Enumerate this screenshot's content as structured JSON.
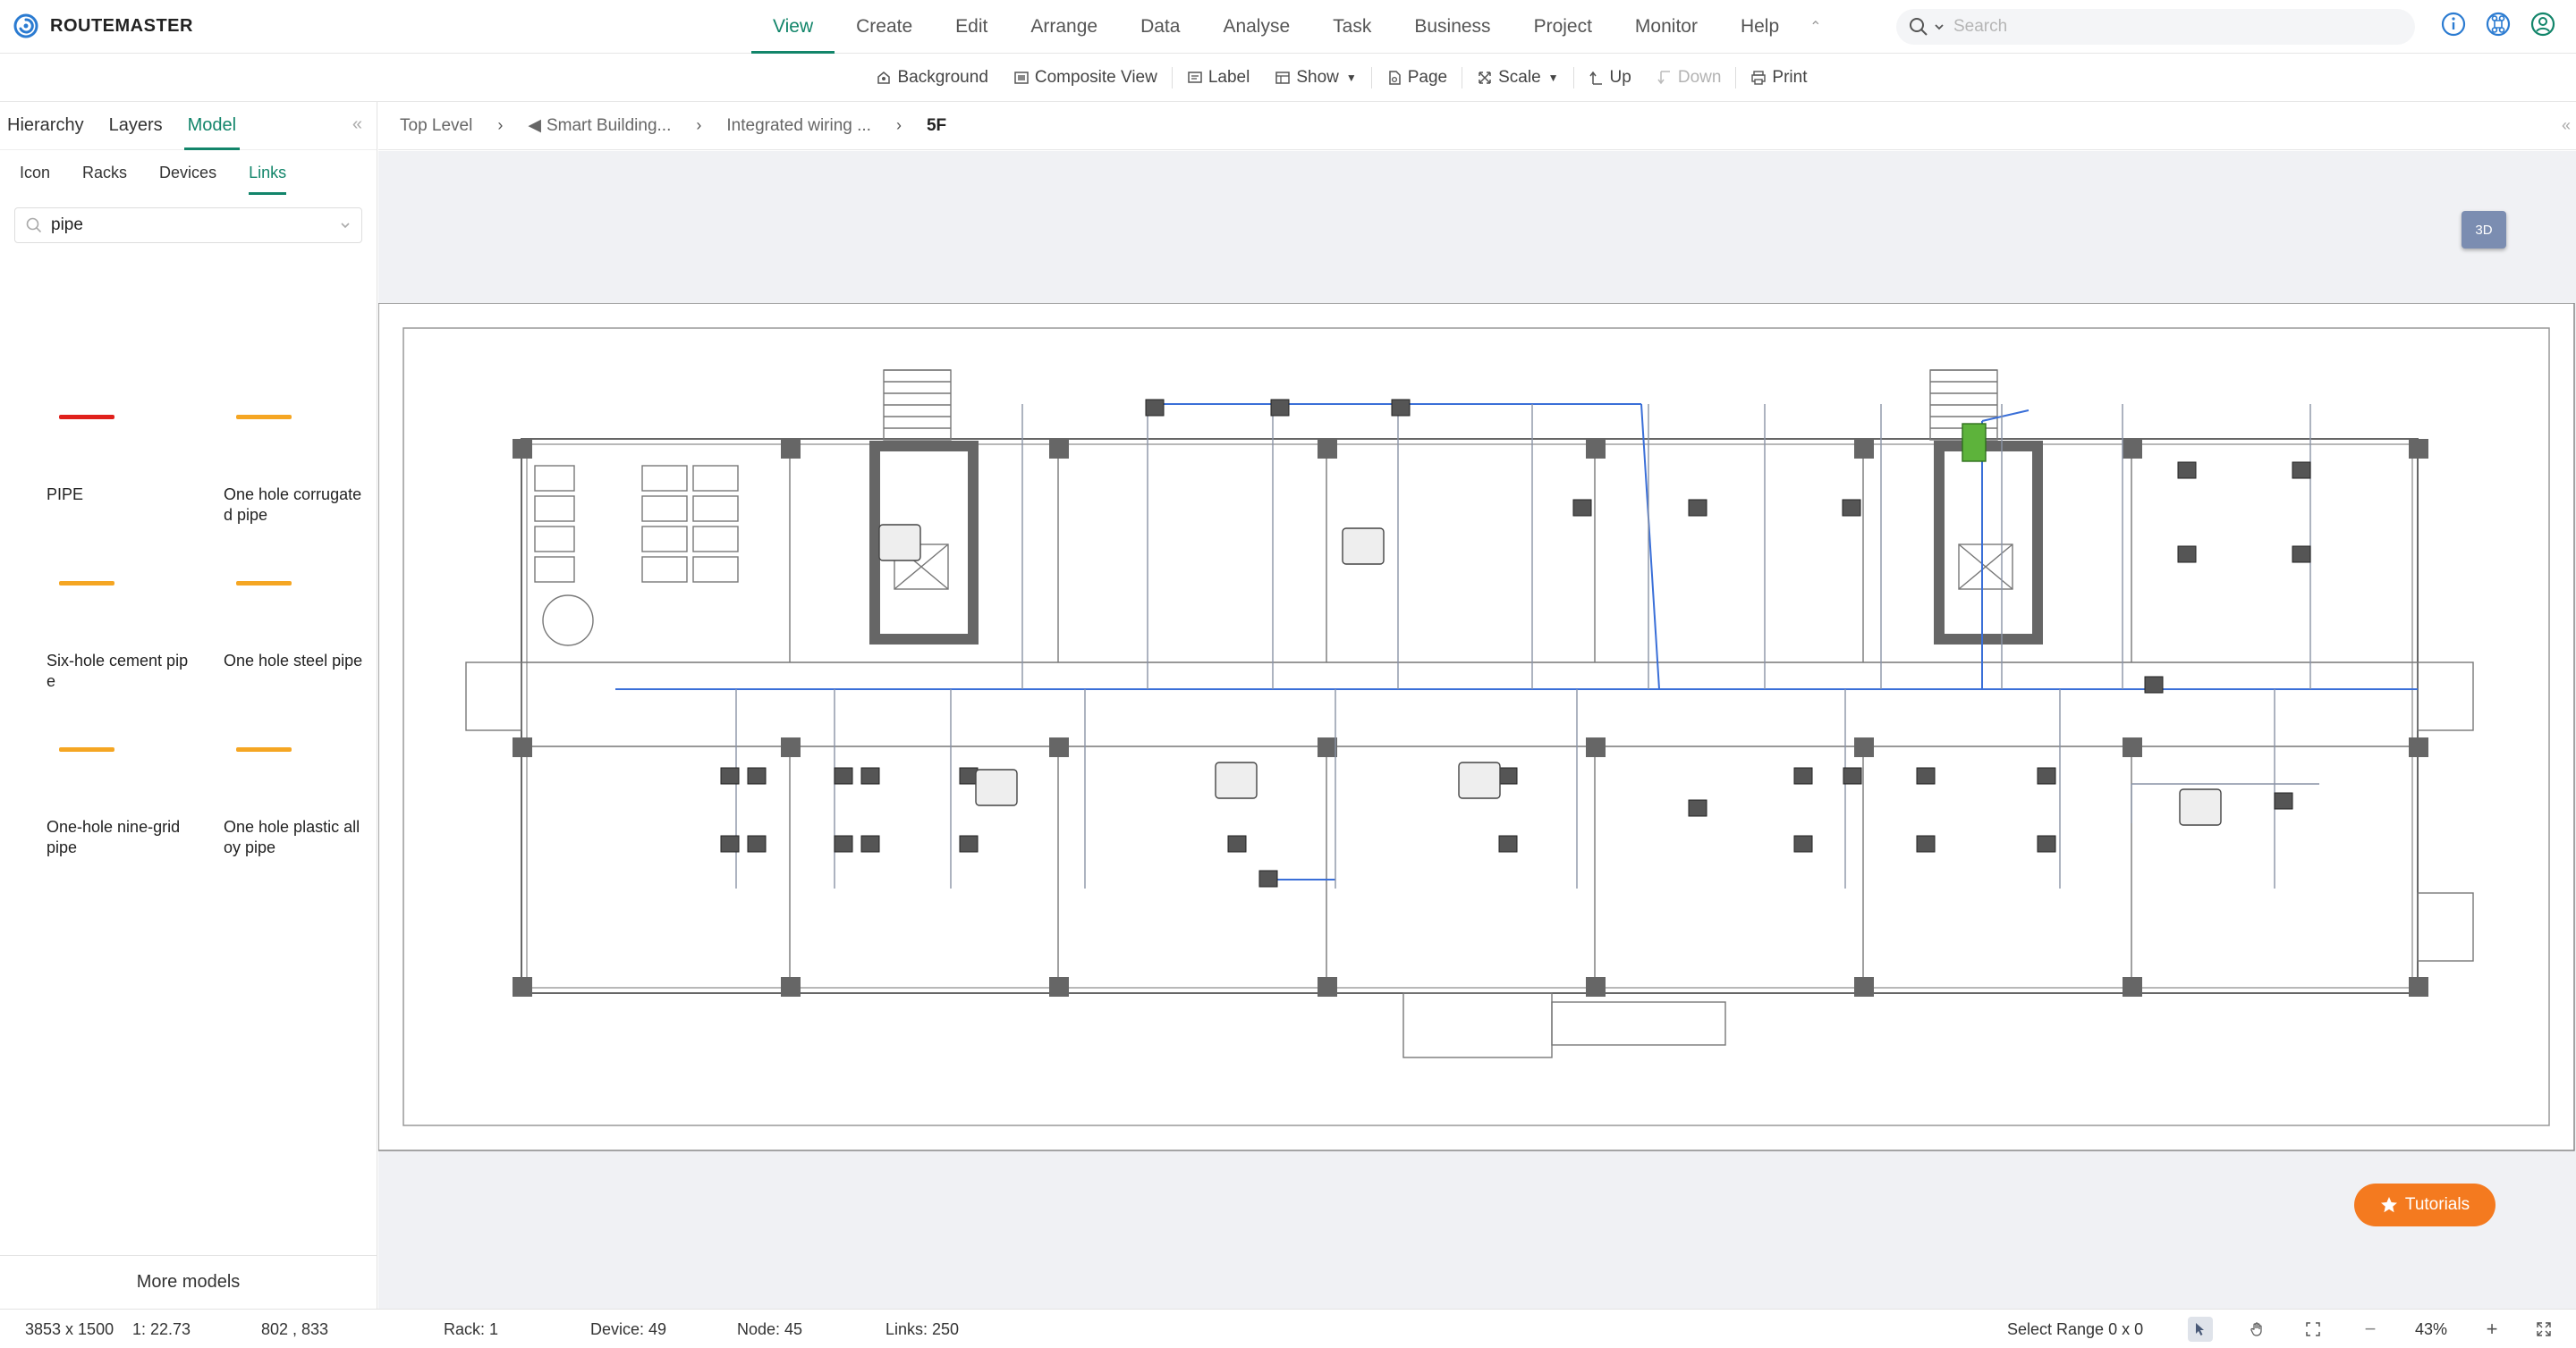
{
  "app": {
    "name": "ROUTEMASTER"
  },
  "menu": [
    "View",
    "Create",
    "Edit",
    "Arrange",
    "Data",
    "Analyse",
    "Task",
    "Business",
    "Project",
    "Monitor",
    "Help"
  ],
  "search": {
    "placeholder": "Search"
  },
  "toolbar": {
    "background": "Background",
    "composite_view": "Composite View",
    "label": "Label",
    "show": "Show",
    "page": "Page",
    "scale": "Scale",
    "up": "Up",
    "down": "Down",
    "print": "Print"
  },
  "left_panel": {
    "tabs": [
      "Hierarchy",
      "Layers",
      "Model"
    ],
    "subtabs": [
      "Icon",
      "Racks",
      "Devices",
      "Links"
    ],
    "search_value": "pipe",
    "models": [
      {
        "label": "PIPE",
        "color": "#e0201b"
      },
      {
        "label": "One hole corrugated pipe",
        "color": "#f5a623"
      },
      {
        "label": "Six-hole cement pipe",
        "color": "#f5a623"
      },
      {
        "label": "One hole steel pipe",
        "color": "#f5a623"
      },
      {
        "label": "One-hole nine-grid pipe",
        "color": "#f5a623"
      },
      {
        "label": "One hole plastic alloy pipe",
        "color": "#f5a623"
      }
    ],
    "more_models": "More models"
  },
  "breadcrumb": [
    "Top Level",
    "Smart Building...",
    "Integrated wiring ...",
    "5F"
  ],
  "canvas": {
    "btn_3d": "3D",
    "tutorials": "Tutorials"
  },
  "status": {
    "size": "3853 x 1500",
    "scale": "1: 22.73",
    "coords": "802 , 833",
    "rack": "Rack: 1",
    "device": "Device: 49",
    "node": "Node: 45",
    "links": "Links: 250",
    "select_range": "Select Range  0 x 0",
    "zoom": "43%"
  },
  "colors": {
    "accent": "#12856a",
    "pipe_red": "#e0201b",
    "pipe_orange": "#f5a623",
    "tutorial": "#f47a1f",
    "link_blue": "#3a6fd8"
  }
}
